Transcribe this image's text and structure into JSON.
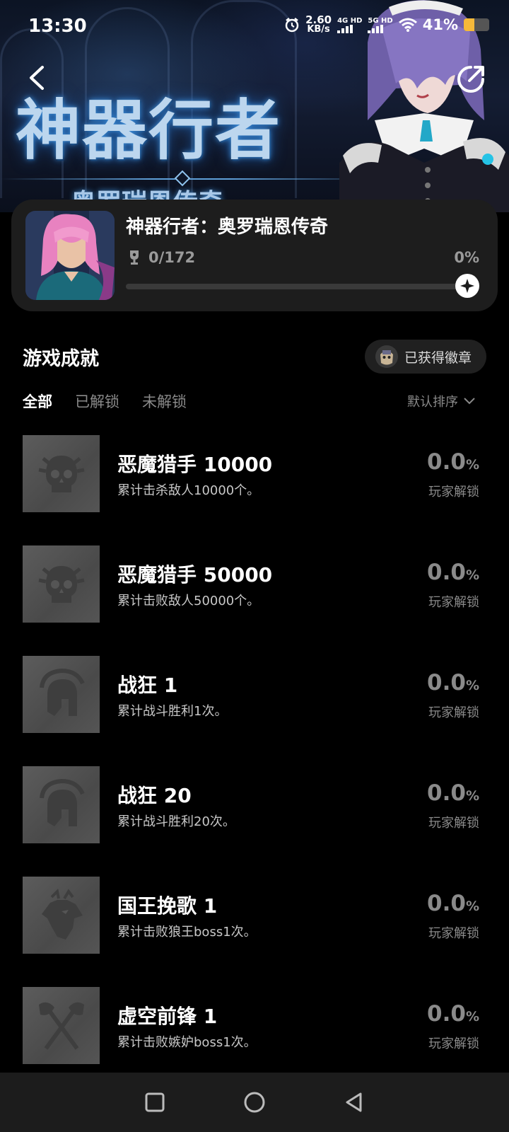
{
  "status_bar": {
    "time": "13:30",
    "speed_value": "2.60",
    "speed_unit": "KB/s",
    "net1": "4G HD",
    "net2": "5G HD",
    "battery_percent": "41%",
    "battery_level": 0.41
  },
  "hero": {
    "title_art": "神器行者",
    "subtitle_art": "奥罗瑞恩传奇"
  },
  "game": {
    "name": "神器行者：奥罗瑞恩传奇",
    "trophy_count": "0/172",
    "progress_percent": "0%",
    "progress_value": 0
  },
  "section": {
    "title": "游戏成就",
    "badge_button": "已获得徽章"
  },
  "tabs": [
    {
      "label": "全部",
      "active": true
    },
    {
      "label": "已解锁",
      "active": false
    },
    {
      "label": "未解锁",
      "active": false
    }
  ],
  "sort_label": "默认排序",
  "achievements": [
    {
      "title": "恶魔猎手 10000",
      "desc": "累计击杀敌人10000个。",
      "pct": "0.0",
      "pct_unit": "%",
      "sub": "玩家解锁",
      "icon": "skull-icon"
    },
    {
      "title": "恶魔猎手 50000",
      "desc": "累计击败敌人50000个。",
      "pct": "0.0",
      "pct_unit": "%",
      "sub": "玩家解锁",
      "icon": "skull-icon"
    },
    {
      "title": "战狂 1",
      "desc": "累计战斗胜利1次。",
      "pct": "0.0",
      "pct_unit": "%",
      "sub": "玩家解锁",
      "icon": "spartan-helmet-icon"
    },
    {
      "title": "战狂 20",
      "desc": "累计战斗胜利20次。",
      "pct": "0.0",
      "pct_unit": "%",
      "sub": "玩家解锁",
      "icon": "spartan-helmet-icon"
    },
    {
      "title": "国王挽歌 1",
      "desc": "累计击败狼王boss1次。",
      "pct": "0.0",
      "pct_unit": "%",
      "sub": "玩家解锁",
      "icon": "wolf-king-icon"
    },
    {
      "title": "虚空前锋 1",
      "desc": "累计击败嫉妒boss1次。",
      "pct": "0.0",
      "pct_unit": "%",
      "sub": "玩家解锁",
      "icon": "crossed-axes-icon"
    }
  ]
}
